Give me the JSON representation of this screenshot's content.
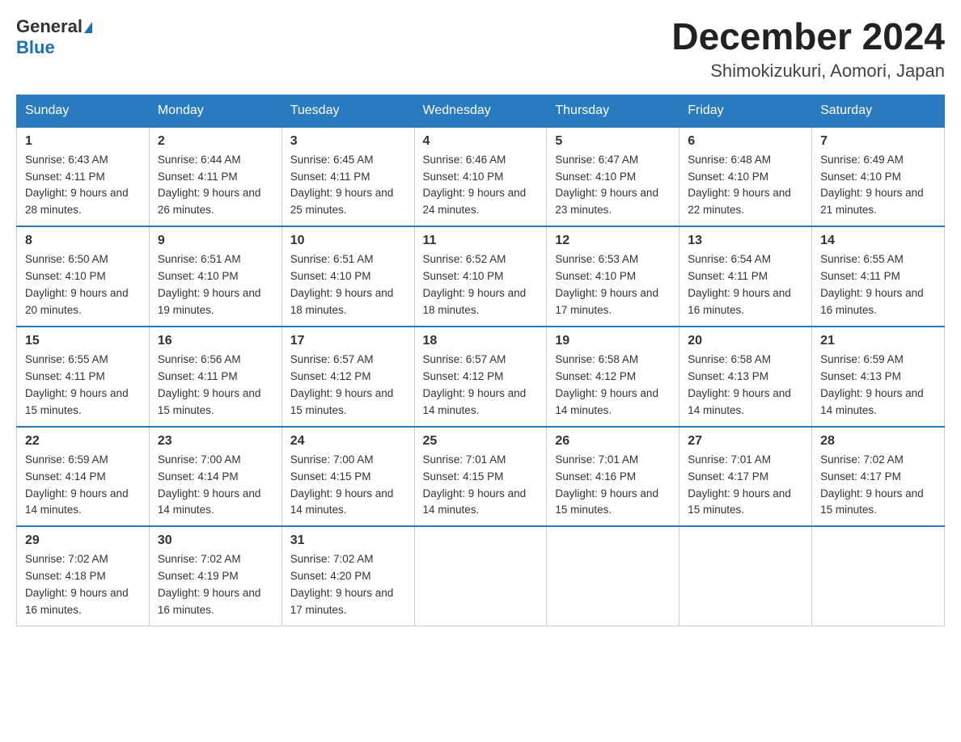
{
  "logo": {
    "line1": "General",
    "line2": "Blue"
  },
  "title": "December 2024",
  "subtitle": "Shimokizukuri, Aomori, Japan",
  "weekdays": [
    "Sunday",
    "Monday",
    "Tuesday",
    "Wednesday",
    "Thursday",
    "Friday",
    "Saturday"
  ],
  "weeks": [
    [
      {
        "day": "1",
        "sunrise": "6:43 AM",
        "sunset": "4:11 PM",
        "daylight": "9 hours and 28 minutes."
      },
      {
        "day": "2",
        "sunrise": "6:44 AM",
        "sunset": "4:11 PM",
        "daylight": "9 hours and 26 minutes."
      },
      {
        "day": "3",
        "sunrise": "6:45 AM",
        "sunset": "4:11 PM",
        "daylight": "9 hours and 25 minutes."
      },
      {
        "day": "4",
        "sunrise": "6:46 AM",
        "sunset": "4:10 PM",
        "daylight": "9 hours and 24 minutes."
      },
      {
        "day": "5",
        "sunrise": "6:47 AM",
        "sunset": "4:10 PM",
        "daylight": "9 hours and 23 minutes."
      },
      {
        "day": "6",
        "sunrise": "6:48 AM",
        "sunset": "4:10 PM",
        "daylight": "9 hours and 22 minutes."
      },
      {
        "day": "7",
        "sunrise": "6:49 AM",
        "sunset": "4:10 PM",
        "daylight": "9 hours and 21 minutes."
      }
    ],
    [
      {
        "day": "8",
        "sunrise": "6:50 AM",
        "sunset": "4:10 PM",
        "daylight": "9 hours and 20 minutes."
      },
      {
        "day": "9",
        "sunrise": "6:51 AM",
        "sunset": "4:10 PM",
        "daylight": "9 hours and 19 minutes."
      },
      {
        "day": "10",
        "sunrise": "6:51 AM",
        "sunset": "4:10 PM",
        "daylight": "9 hours and 18 minutes."
      },
      {
        "day": "11",
        "sunrise": "6:52 AM",
        "sunset": "4:10 PM",
        "daylight": "9 hours and 18 minutes."
      },
      {
        "day": "12",
        "sunrise": "6:53 AM",
        "sunset": "4:10 PM",
        "daylight": "9 hours and 17 minutes."
      },
      {
        "day": "13",
        "sunrise": "6:54 AM",
        "sunset": "4:11 PM",
        "daylight": "9 hours and 16 minutes."
      },
      {
        "day": "14",
        "sunrise": "6:55 AM",
        "sunset": "4:11 PM",
        "daylight": "9 hours and 16 minutes."
      }
    ],
    [
      {
        "day": "15",
        "sunrise": "6:55 AM",
        "sunset": "4:11 PM",
        "daylight": "9 hours and 15 minutes."
      },
      {
        "day": "16",
        "sunrise": "6:56 AM",
        "sunset": "4:11 PM",
        "daylight": "9 hours and 15 minutes."
      },
      {
        "day": "17",
        "sunrise": "6:57 AM",
        "sunset": "4:12 PM",
        "daylight": "9 hours and 15 minutes."
      },
      {
        "day": "18",
        "sunrise": "6:57 AM",
        "sunset": "4:12 PM",
        "daylight": "9 hours and 14 minutes."
      },
      {
        "day": "19",
        "sunrise": "6:58 AM",
        "sunset": "4:12 PM",
        "daylight": "9 hours and 14 minutes."
      },
      {
        "day": "20",
        "sunrise": "6:58 AM",
        "sunset": "4:13 PM",
        "daylight": "9 hours and 14 minutes."
      },
      {
        "day": "21",
        "sunrise": "6:59 AM",
        "sunset": "4:13 PM",
        "daylight": "9 hours and 14 minutes."
      }
    ],
    [
      {
        "day": "22",
        "sunrise": "6:59 AM",
        "sunset": "4:14 PM",
        "daylight": "9 hours and 14 minutes."
      },
      {
        "day": "23",
        "sunrise": "7:00 AM",
        "sunset": "4:14 PM",
        "daylight": "9 hours and 14 minutes."
      },
      {
        "day": "24",
        "sunrise": "7:00 AM",
        "sunset": "4:15 PM",
        "daylight": "9 hours and 14 minutes."
      },
      {
        "day": "25",
        "sunrise": "7:01 AM",
        "sunset": "4:15 PM",
        "daylight": "9 hours and 14 minutes."
      },
      {
        "day": "26",
        "sunrise": "7:01 AM",
        "sunset": "4:16 PM",
        "daylight": "9 hours and 15 minutes."
      },
      {
        "day": "27",
        "sunrise": "7:01 AM",
        "sunset": "4:17 PM",
        "daylight": "9 hours and 15 minutes."
      },
      {
        "day": "28",
        "sunrise": "7:02 AM",
        "sunset": "4:17 PM",
        "daylight": "9 hours and 15 minutes."
      }
    ],
    [
      {
        "day": "29",
        "sunrise": "7:02 AM",
        "sunset": "4:18 PM",
        "daylight": "9 hours and 16 minutes."
      },
      {
        "day": "30",
        "sunrise": "7:02 AM",
        "sunset": "4:19 PM",
        "daylight": "9 hours and 16 minutes."
      },
      {
        "day": "31",
        "sunrise": "7:02 AM",
        "sunset": "4:20 PM",
        "daylight": "9 hours and 17 minutes."
      },
      null,
      null,
      null,
      null
    ]
  ]
}
